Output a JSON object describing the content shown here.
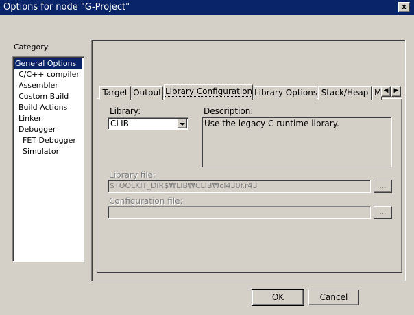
{
  "window": {
    "title": "Options for node \"G-Project\"",
    "close_label": "x"
  },
  "category": {
    "label": "Category:",
    "items": [
      {
        "label": "General Options"
      },
      {
        "label": "C/C++ compiler"
      },
      {
        "label": "Assembler"
      },
      {
        "label": "Custom Build"
      },
      {
        "label": "Build Actions"
      },
      {
        "label": "Linker"
      },
      {
        "label": "Debugger"
      },
      {
        "label": "FET Debugger"
      },
      {
        "label": "Simulator"
      }
    ],
    "selected": "General Options"
  },
  "tabs": [
    {
      "label": "Target"
    },
    {
      "label": "Output"
    },
    {
      "label": "Library Configuration"
    },
    {
      "label": "Library Options"
    },
    {
      "label": "Stack/Heap"
    },
    {
      "label": "M"
    }
  ],
  "active_tab": "Library Configuration",
  "tab_scroll": {
    "left": "◀",
    "right": "▶"
  },
  "library": {
    "label": "Library:",
    "value": "CLIB"
  },
  "description": {
    "label": "Description:",
    "text": "Use the legacy C runtime library."
  },
  "library_file": {
    "label": "Library file:",
    "value": "$TOOLKIT_DIR$₩LIB₩CLIB₩cl430f.r43",
    "browse_label": "..."
  },
  "configuration_file": {
    "label": "Configuration file:",
    "value": "",
    "browse_label": "..."
  },
  "buttons": {
    "ok": "OK",
    "cancel": "Cancel"
  }
}
